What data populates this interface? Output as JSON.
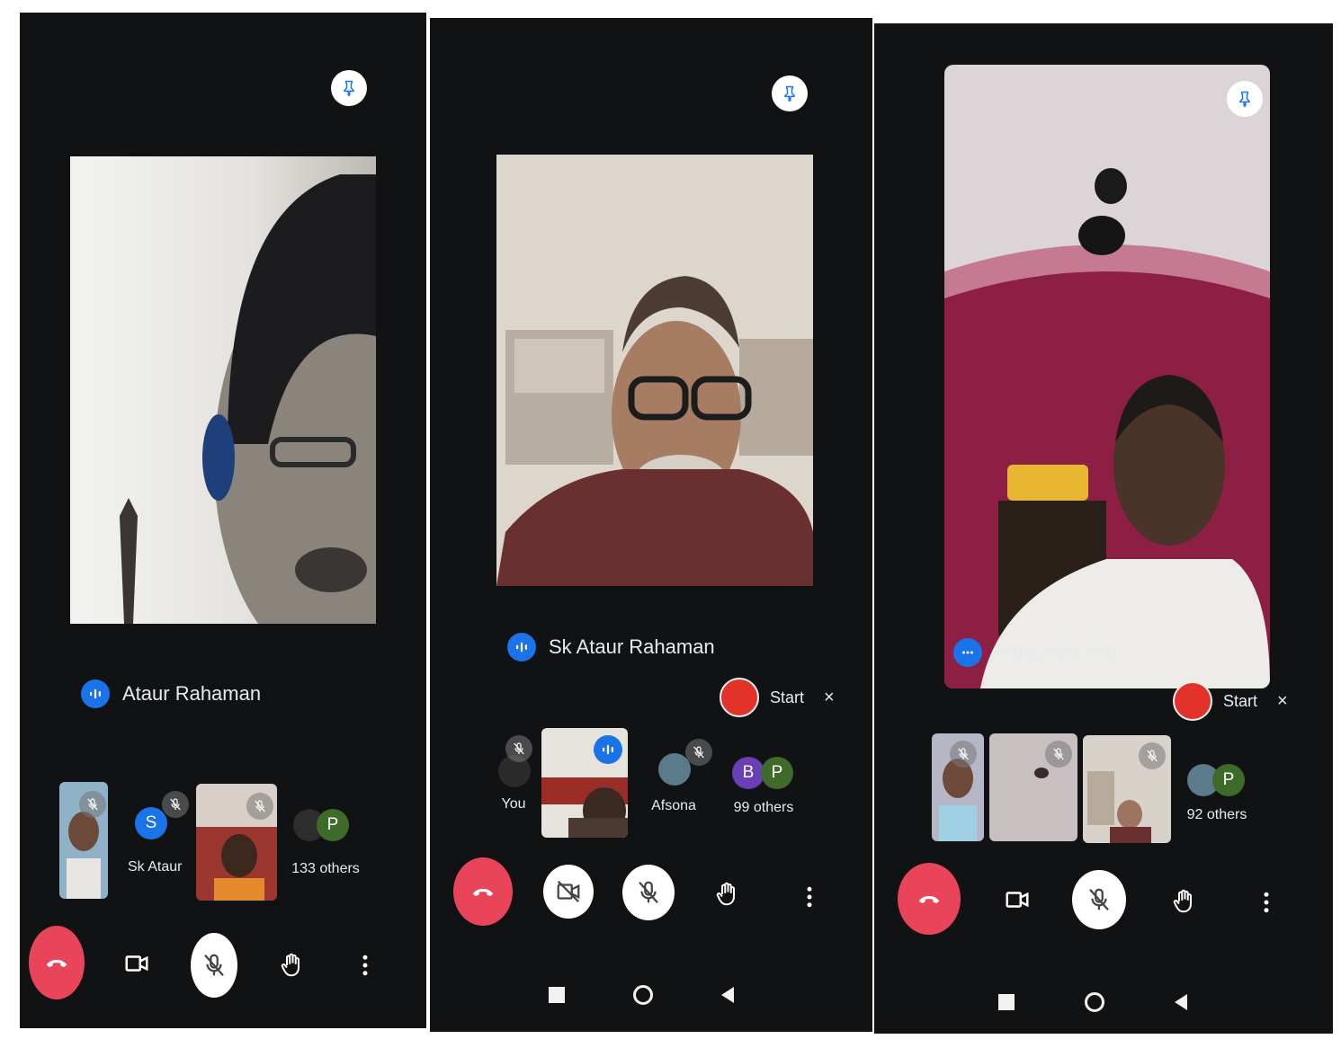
{
  "screens": [
    {
      "speaker": {
        "name": "Ataur Rahaman",
        "icon": "audio-wave-icon"
      },
      "participants": [
        {
          "label": "",
          "muted": true
        },
        {
          "label": "Sk Ataur",
          "avatar_letter": "S",
          "avatar_color": "#1a73e8",
          "muted": true
        },
        {
          "label": "",
          "muted": true
        },
        {
          "label": "133 others",
          "avatar_letter": "P",
          "avatar_color": "#3f6b2a"
        }
      ],
      "controls": [
        "end-call-icon",
        "camera-icon",
        "mic-off-icon",
        "raise-hand-icon",
        "more-vert-icon"
      ]
    },
    {
      "speaker": {
        "name": "Sk Ataur Rahaman",
        "icon": "audio-wave-icon"
      },
      "recording": {
        "label": "Start",
        "close": "×"
      },
      "participants": [
        {
          "label": "You",
          "muted": true
        },
        {
          "label": "",
          "speaking": true
        },
        {
          "label": "Afsona",
          "muted": true
        },
        {
          "label": "99 others",
          "avatar_letters": [
            "B",
            "P"
          ],
          "avatar_colors": [
            "#6a3fb5",
            "#3f6b2a"
          ]
        }
      ],
      "controls": [
        "end-call-icon",
        "camera-off-icon",
        "mic-off-icon",
        "raise-hand-icon",
        "more-vert-icon"
      ],
      "nav": [
        "recents-square-icon",
        "home-circle-icon",
        "back-triangle-icon"
      ]
    },
    {
      "speaker": {
        "name": "Baikuntha Pal",
        "icon": "dots-icon"
      },
      "recording": {
        "label": "Start",
        "close": "×"
      },
      "participants": [
        {
          "label": "",
          "muted": true
        },
        {
          "label": "",
          "muted": true
        },
        {
          "label": "",
          "muted": true
        },
        {
          "label": "92 others",
          "avatar_letter": "P",
          "avatar_color": "#3f6b2a"
        }
      ],
      "controls": [
        "end-call-icon",
        "camera-icon",
        "mic-off-icon",
        "raise-hand-icon",
        "more-vert-icon"
      ],
      "nav": [
        "recents-square-icon",
        "home-circle-icon",
        "back-triangle-icon"
      ]
    }
  ],
  "colors": {
    "background": "#111214",
    "accent": "#1a73e8",
    "end_call": "#e8445a",
    "record": "#e3322a"
  }
}
